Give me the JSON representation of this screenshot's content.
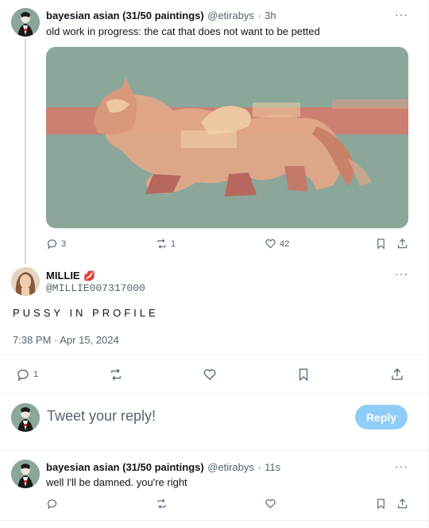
{
  "tweet1": {
    "name": "bayesian asian (31/50 paintings)",
    "handle": "@etirabys",
    "separator": "·",
    "time": "3h",
    "text": "old work in progress: the cat that does not want to be petted",
    "image_alt": "painting of a cat crouching in profile",
    "replies": "3",
    "retweets": "1",
    "likes": "42"
  },
  "tweet2": {
    "name": "MILLIE",
    "emoji": "💋",
    "handle": "@MILLIE007317000",
    "text": "PUSSY IN PROFILE",
    "timestamp": "7:38 PM · Apr 15, 2024",
    "replies": "1"
  },
  "composer": {
    "placeholder": "Tweet your reply!",
    "button": "Reply"
  },
  "tweet3": {
    "name": "bayesian asian (31/50 paintings)",
    "handle": "@etirabys",
    "separator": "·",
    "time": "11s",
    "text": "well I'll be damned. you're right"
  },
  "icons": {
    "more": "more-icon",
    "reply": "reply-icon",
    "retweet": "retweet-icon",
    "like": "heart-icon",
    "bookmark": "bookmark-icon",
    "share": "share-icon"
  },
  "colors": {
    "accent_disabled": "#8ecdf8",
    "painting_bg": "#8aa79a",
    "painting_stripe": "#d47b6e"
  }
}
